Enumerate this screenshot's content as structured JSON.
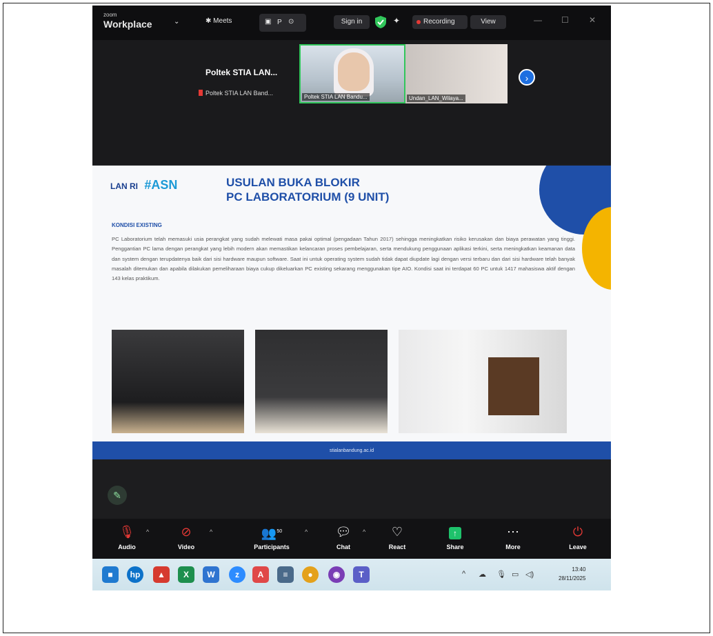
{
  "titlebar": {
    "app_small": "zoom",
    "app_name": "Workplace",
    "meets_tab": "Meets",
    "meeting_tab_short": "P",
    "signin": "Sign in",
    "recording": "Recording",
    "view": "View"
  },
  "strip": {
    "host_name": "Poltek STIA LAN...",
    "host_sub": "Poltek STIA LAN Band...",
    "tile1_label": "Poltek STIA LAN Bandu...",
    "tile2_label": "Undan_LAN_Wilaya..."
  },
  "slide": {
    "logo_text": "LAN RI",
    "hashtag": "#ASN",
    "title_line1": "USULAN BUKA BLOKIR",
    "title_line2": "PC LABORATORIUM (9 UNIT)",
    "section_heading": "KONDISI EXISTING",
    "paragraph": "PC Laboratorium telah memasuki usia perangkat yang sudah melewati masa pakai optimal (pengadaan Tahun 2017) sehingga meningkatkan risiko kerusakan dan biaya perawatan yang tinggi. Penggantian PC lama dengan perangkat yang lebih modern akan memastikan kelancaran proses pembelajaran, serta mendukung penggunaan aplikasi terkini, serta meningkatkan keamanan data dan system dengan terupdatenya baik dari sisi hardware maupun software. Saat ini untuk operating system sudah tidak dapat diupdate lagi dengan versi terbaru dan dari sisi hardware telah banyak masalah ditemukan dan apabila dilakukan pemeliharaan biaya cukup dikeluarkan PC existing sekarang menggunakan tipe AIO. Kondisi saat ini terdapat 60 PC untuk 1417 mahasiswa aktif dengan 143 kelas praktikum.",
    "footer_url": "stialanbandung.ac.id"
  },
  "toolbar": {
    "audio": "Audio",
    "video": "Video",
    "participants": "Participants",
    "participants_count": "50",
    "chat": "Chat",
    "react": "React",
    "share": "Share",
    "more": "More",
    "leave": "Leave"
  },
  "taskbar": {
    "time": "13:40",
    "date": "28/11/2025"
  },
  "colors": {
    "zoom_bg": "#1d1d1f",
    "slide_blue": "#1f4fa8",
    "slide_yellow": "#f4b400",
    "active_green": "#31c65b",
    "share_green": "#1ec26b"
  }
}
